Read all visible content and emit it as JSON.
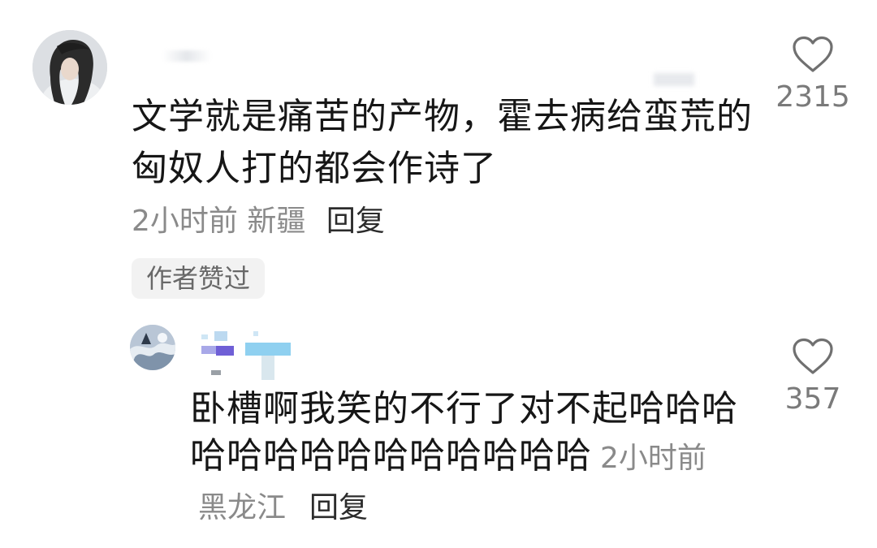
{
  "comments": [
    {
      "avatar": "avatar-dark-haired-figure",
      "text": "文学就是痛苦的产物，霍去病给蛮荒的匈奴人打的都会作诗了",
      "time": "2小时前",
      "location": "新疆",
      "reply_label": "回复",
      "author_liked_label": "作者赞过",
      "like_count": "2315",
      "like_icon": "heart-outline-icon"
    },
    {
      "avatar": "avatar-landscape",
      "text": "卧槽啊我笑的不行了对不起哈哈哈哈哈哈哈哈哈哈哈哈哈哈",
      "time": "2小时前",
      "location": "黑龙江",
      "reply_label": "回复",
      "like_count": "357",
      "like_icon": "heart-outline-icon"
    }
  ],
  "colors": {
    "text": "#161616",
    "meta": "#8a8a8a",
    "badge_bg": "#f2f2f2",
    "like_count": "#7a7a7a"
  }
}
